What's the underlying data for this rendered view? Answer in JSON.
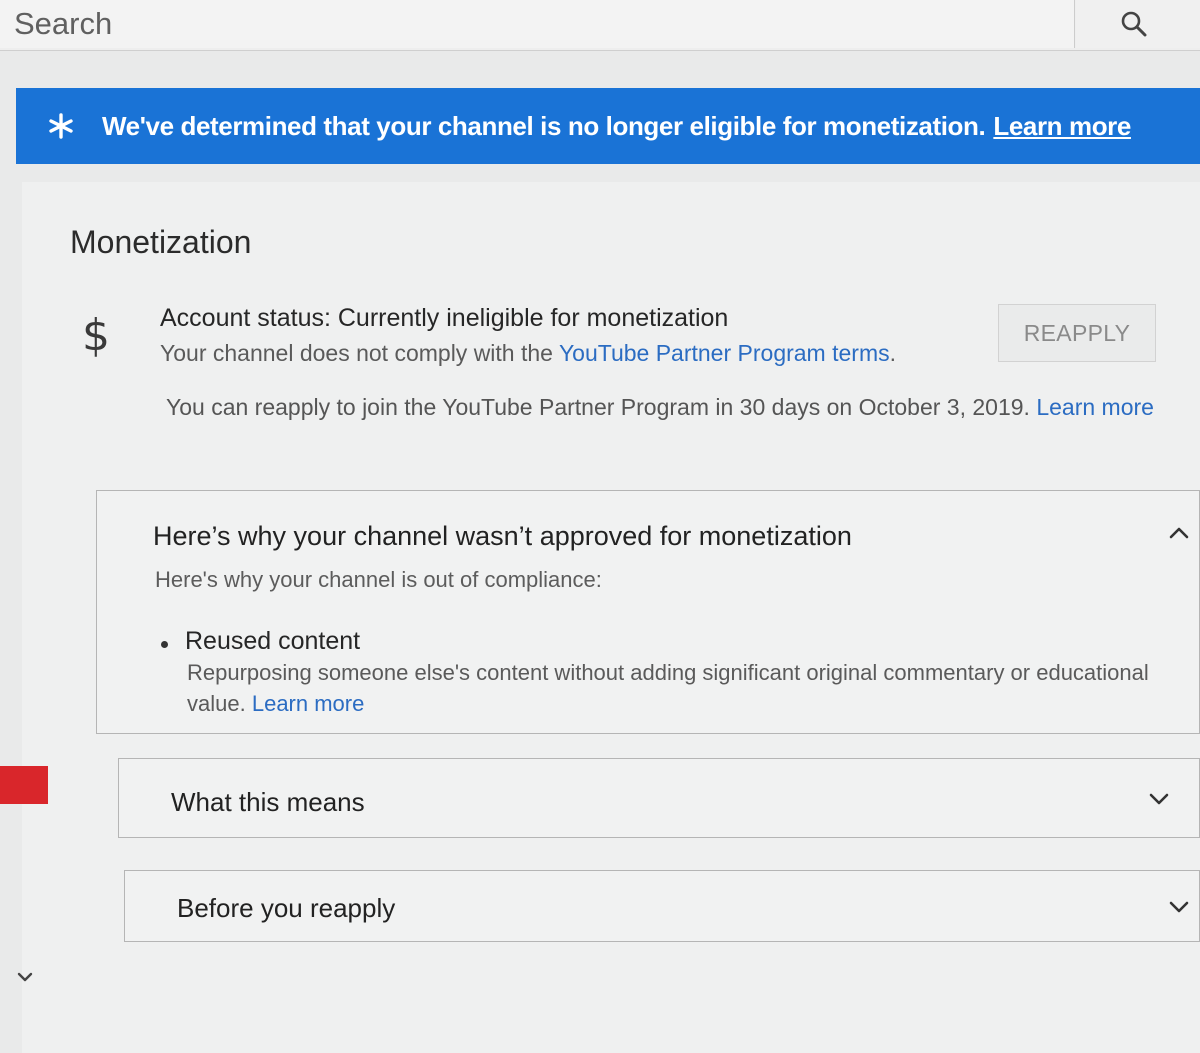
{
  "search": {
    "placeholder": "Search",
    "button_icon": "search-icon"
  },
  "banner": {
    "icon": "star-icon",
    "message": "We've determined that your channel is no longer eligible for monetization.",
    "link_label": "Learn more",
    "background_color": "#1a73d6"
  },
  "monetization": {
    "title": "Monetization",
    "icon": "dollar-icon",
    "icon_glyph": "$",
    "status_title": "Account status: Currently ineligible for monetization",
    "status_prefix": "Your channel does not comply with the ",
    "status_link": "YouTube Partner Program terms",
    "status_suffix": ".",
    "reapply_button": "REAPPLY",
    "reapply_note": "You can reapply to join the YouTube Partner Program in 30 days on October 3, 2019.",
    "reapply_note_link": "Learn more"
  },
  "accordions": {
    "why": {
      "title": "Here’s why your channel wasn’t approved for monetization",
      "subtitle": "Here's why your channel is out of compliance:",
      "expanded": true,
      "chevron_icon": "chevron-up-icon",
      "reasons": [
        {
          "title": "Reused content",
          "description": "Repurposing someone else's content without adding significant original commentary or educational value.",
          "link": "Learn more"
        }
      ]
    },
    "means": {
      "title": "What this means",
      "expanded": false,
      "chevron_icon": "chevron-down-icon"
    },
    "before": {
      "title": "Before you reapply",
      "expanded": false,
      "chevron_icon": "chevron-down-icon"
    }
  },
  "sidebar": {
    "active_color": "#d9262b",
    "expand_icon": "chevron-down-icon"
  },
  "colors": {
    "link": "#2b6cc2",
    "page_background": "#e9eaea"
  }
}
